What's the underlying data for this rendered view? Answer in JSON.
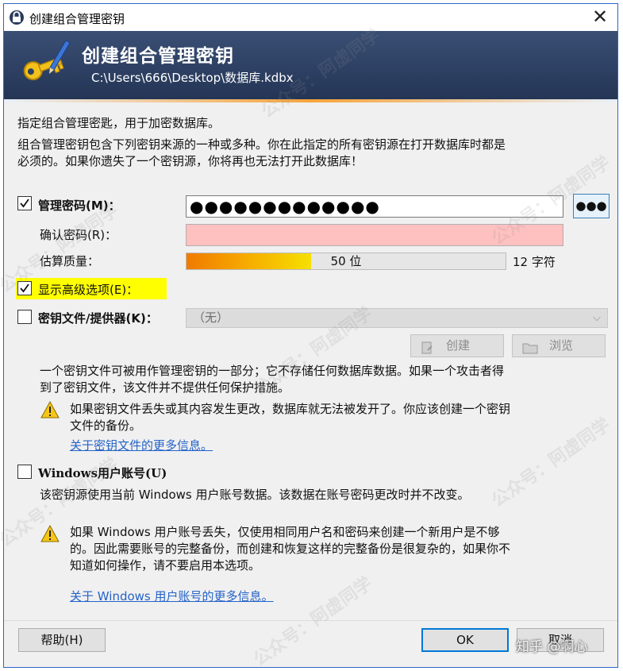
{
  "window": {
    "title": "创建组合管理密钥",
    "close_glyph": "✕"
  },
  "banner": {
    "title": "创建组合管理密钥",
    "path": "C:\\Users\\666\\Desktop\\数据库.kdbx"
  },
  "intro": {
    "line1": "指定组合管理密匙，用于加密数据库。",
    "line2": "组合管理密钥包含下列密钥来源的一种或多种。你在此指定的所有密钥源在打开数据库时都是",
    "line3": "必须的。如果你遗失了一个密钥源，你将再也无法打开此数据库！"
  },
  "master_password": {
    "label": "管理密码(M)：",
    "value": "●●●●●●●●●●●●●",
    "checked": true,
    "reveal_button": "●●●"
  },
  "confirm_password": {
    "label": "确认密码(R)：",
    "value": ""
  },
  "quality": {
    "label": "估算质量：",
    "bits_text": "50 位",
    "fill_fraction": 0.39,
    "chars_text": "12 字符"
  },
  "advanced": {
    "label": "显示高级选项(E)：",
    "checked": true
  },
  "key_file": {
    "label": "密钥文件/提供器(K)：",
    "checked": false,
    "combo_value": "（无）",
    "create_button": "创建",
    "browse_button": "浏览",
    "desc1": "一个密钥文件可被用作管理密钥的一部分；它不存储任何数据库数据。如果一个攻击者得",
    "desc2": "到了密钥文件，该文件并不提供任何保护措施。",
    "warn1": "如果密钥文件丢失或其内容发生更改，数据库就无法被发开了。你应该创建一个密钥",
    "warn2": "文件的备份。",
    "link": "关于密钥文件的更多信息。"
  },
  "windows_account": {
    "label": "Windows用户账号(U)",
    "checked": false,
    "desc": "该密钥源使用当前 Windows 用户账号数据。该数据在账号密码更改时并不改变。",
    "warn1": "如果 Windows 用户账号丢失，仅使用相同用户名和密码来创建一个新用户是不够",
    "warn2": "的。因此需要账号的完整备份，而创建和恢复这样的完整备份是很复杂的，如果你不",
    "warn3": "知道如何操作，请不要启用本选项。",
    "link": "关于 Windows 用户账号的更多信息。"
  },
  "footer": {
    "help_button": "帮助(H)",
    "ok_button": "OK",
    "cancel_button": "取消"
  },
  "watermarks": {
    "account": "公众号：阿虚同学",
    "zhihu": "知乎 @啊心"
  },
  "colors": {
    "accent_border": "#0078d7",
    "banner_bg": "#2e4164",
    "confirm_error_bg": "#ffc0c0",
    "highlight": "#ffff00",
    "link": "#2563c9"
  }
}
